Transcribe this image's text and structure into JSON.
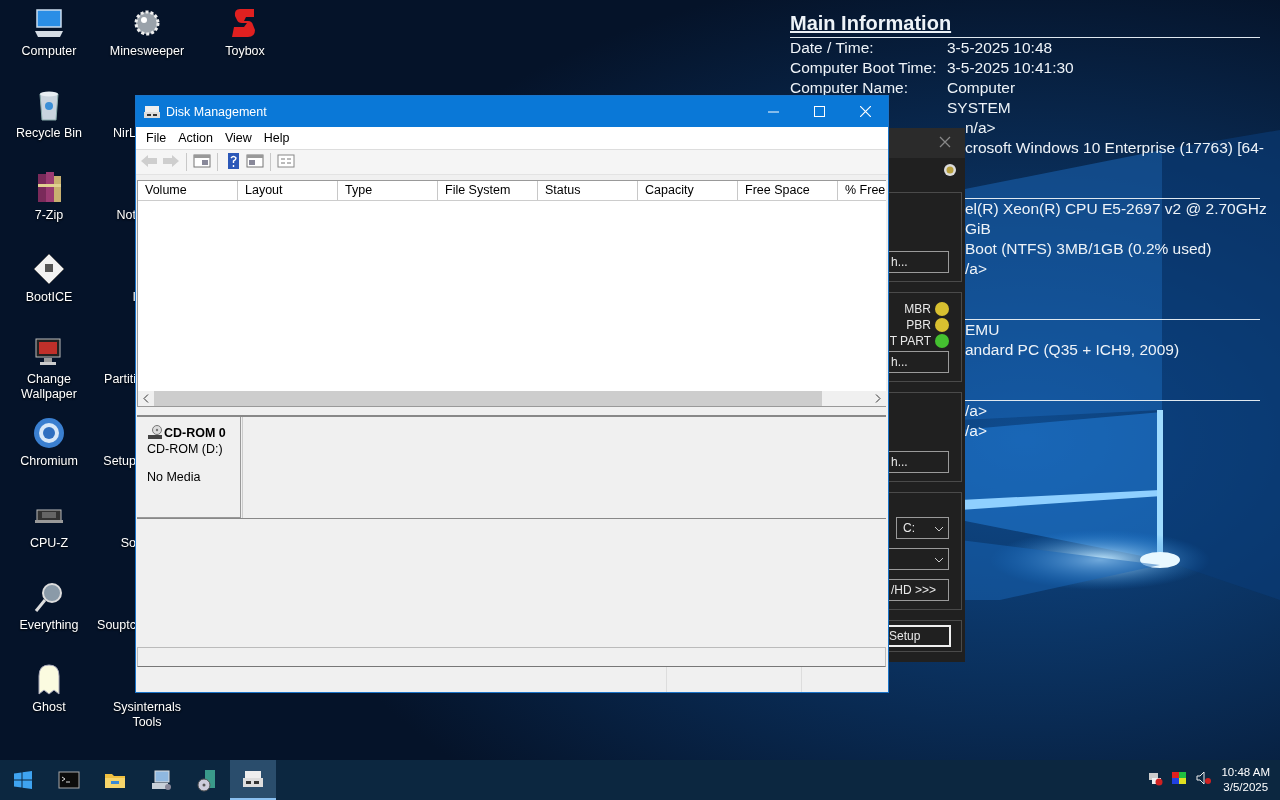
{
  "desktop": {
    "icon_columns": [
      {
        "items": [
          {
            "label": "Computer",
            "kind": "monitor"
          },
          {
            "label": "Recycle Bin",
            "kind": "bin"
          },
          {
            "label": "7-Zip",
            "kind": "books"
          },
          {
            "label": "BootICE",
            "kind": "floppy"
          },
          {
            "label": "Change Wallpaper",
            "kind": "wallpaper"
          },
          {
            "label": "Chromium",
            "kind": "globe"
          },
          {
            "label": "CPU-Z",
            "kind": "chip"
          },
          {
            "label": "Everything",
            "kind": "magnifier"
          },
          {
            "label": "Ghost",
            "kind": "ghost"
          }
        ]
      },
      {
        "items": [
          {
            "label": "Minesweeper",
            "kind": "mine"
          },
          {
            "label": "NirL",
            "kind": "partial"
          },
          {
            "label": "Not",
            "kind": "partial"
          },
          {
            "label": "I",
            "kind": "partial"
          },
          {
            "label": "Partiti",
            "kind": "partial"
          },
          {
            "label": "Setup",
            "kind": "partial"
          },
          {
            "label": "So",
            "kind": "partial"
          },
          {
            "label": "Souptc",
            "kind": "partial"
          },
          {
            "label": "Sysinternals Tools",
            "kind": "label"
          }
        ]
      },
      {
        "items": [
          {
            "label": "Toybox",
            "kind": "zigzag"
          }
        ]
      }
    ]
  },
  "info_panel": {
    "title": "Main Information",
    "sections": [
      {
        "rows": [
          {
            "label": "Date / Time:",
            "value": "3-5-2025 10:48"
          },
          {
            "label": "Computer Boot Time:",
            "value": "3-5-2025 10:41:30"
          },
          {
            "label": "Computer Name:",
            "value": "Computer"
          },
          {
            "value": "SYSTEM",
            "kind": "value"
          },
          {
            "value": "n/a>",
            "kind": "partial"
          },
          {
            "value": "crosoft Windows 10 Enterprise (17763) [64-",
            "kind": "partial"
          }
        ]
      },
      {
        "rows": [
          {
            "value": "el(R) Xeon(R) CPU E5-2697 v2 @ 2.70GHz",
            "kind": "partial"
          },
          {
            "value": "GiB",
            "kind": "partial"
          },
          {
            "value": "Boot (NTFS) 3MB/1GB (0.2% used)",
            "kind": "partial"
          },
          {
            "value": "/a>",
            "kind": "partial"
          }
        ]
      },
      {
        "rows": [
          {
            "value": "EMU",
            "kind": "partial"
          },
          {
            "value": "andard PC (Q35 + ICH9, 2009)",
            "kind": "partial"
          }
        ]
      },
      {
        "rows": [
          {
            "value": "/a>",
            "kind": "partial"
          },
          {
            "value": "/a>",
            "kind": "partial"
          }
        ]
      }
    ]
  },
  "tool_window": {
    "groups": [
      {
        "controls": [
          {
            "kind": "button",
            "label": "h..."
          }
        ]
      },
      {
        "controls": [
          {
            "kind": "status",
            "label": "MBR",
            "color": "#d8c030"
          },
          {
            "kind": "status",
            "label": "PBR",
            "color": "#d8c030"
          },
          {
            "kind": "status",
            "label": "T PART",
            "color": "#44c030"
          },
          {
            "kind": "button",
            "label": "h..."
          }
        ]
      },
      {
        "controls": [
          {
            "kind": "button",
            "label": "h..."
          }
        ]
      },
      {
        "controls": [
          {
            "kind": "combo",
            "value": "C:"
          },
          {
            "kind": "combo"
          },
          {
            "kind": "button",
            "label": "/HD >>>"
          }
        ]
      },
      {
        "controls": [
          {
            "kind": "button",
            "label": "Setup"
          }
        ]
      }
    ]
  },
  "disk_management": {
    "title": "Disk Management",
    "menu": [
      "File",
      "Action",
      "View",
      "Help"
    ],
    "toolbar": [
      {
        "kind": "back",
        "disabled": true
      },
      {
        "kind": "forward",
        "disabled": true
      },
      {
        "kind": "pane",
        "disabled": false
      },
      {
        "kind": "help",
        "disabled": false
      },
      {
        "kind": "pane2",
        "disabled": false
      },
      {
        "kind": "list",
        "disabled": false
      }
    ],
    "columns": [
      "Volume",
      "Layout",
      "Type",
      "File System",
      "Status",
      "Capacity",
      "Free Space",
      "% Free"
    ],
    "disks": [
      {
        "name": "CD-ROM 0",
        "detail": "CD-ROM (D:)",
        "status": "No Media"
      }
    ]
  },
  "taskbar": {
    "apps": [
      {
        "kind": "terminal",
        "selected": false
      },
      {
        "kind": "folder",
        "selected": false
      },
      {
        "kind": "computer",
        "selected": false
      },
      {
        "kind": "disc",
        "selected": false
      },
      {
        "kind": "drive",
        "selected": true
      }
    ],
    "tray": [
      {
        "kind": "network"
      },
      {
        "kind": "colors"
      },
      {
        "kind": "speaker"
      }
    ],
    "clock": {
      "time": "10:48 AM",
      "date": "3/5/2025"
    }
  }
}
